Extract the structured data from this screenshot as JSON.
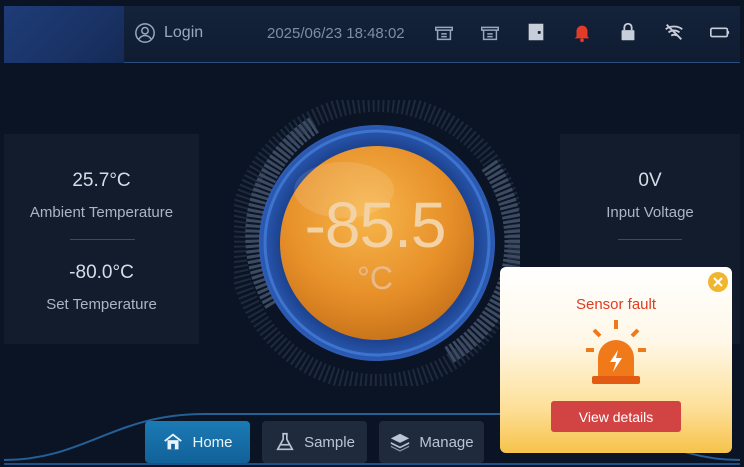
{
  "header": {
    "login_label": "Login",
    "datetime": "2025/06/23 18:48:02",
    "status_icons": [
      "cabinet-icon",
      "cabinet-icon",
      "door-icon",
      "alarm-bell-icon",
      "lock-icon",
      "wifi-icon",
      "battery-icon"
    ]
  },
  "left_panel": {
    "ambient_value": "25.7°C",
    "ambient_label": "Ambient Temperature",
    "set_value": "-80.0°C",
    "set_label": "Set Temperature"
  },
  "right_panel": {
    "voltage_value": "0V",
    "voltage_label": "Input Voltage"
  },
  "gauge": {
    "temperature": "-85.5",
    "unit": "°C"
  },
  "nav": {
    "items": [
      {
        "label": "Home",
        "active": true
      },
      {
        "label": "Sample",
        "active": false
      },
      {
        "label": "Manage",
        "active": false
      }
    ]
  },
  "popup": {
    "title": "Sensor fault",
    "button_label": "View details"
  },
  "colors": {
    "accent": "#1b7ab4",
    "alarm": "#e03a1f",
    "gauge_orange": "#f0a030"
  }
}
